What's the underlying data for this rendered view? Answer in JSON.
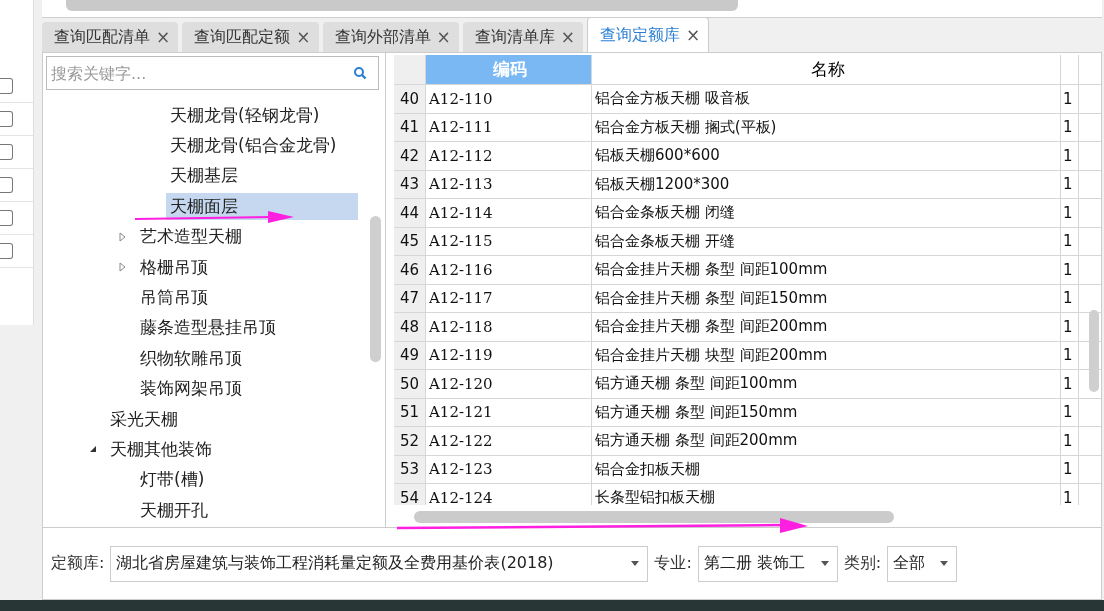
{
  "left_checkboxes": [
    {
      "checked": false
    },
    {
      "checked": false
    },
    {
      "checked": false
    },
    {
      "checked": false
    },
    {
      "checked": false
    },
    {
      "checked": false
    }
  ],
  "tabs": [
    {
      "label": "查询匹配清单",
      "selected": false,
      "close": "×"
    },
    {
      "label": "查询匹配定额",
      "selected": false,
      "close": "×"
    },
    {
      "label": "查询外部清单",
      "selected": false,
      "close": "×"
    },
    {
      "label": "查询清单库",
      "selected": false,
      "close": "×"
    },
    {
      "label": "查询定额库",
      "selected": true,
      "close": "×"
    }
  ],
  "search": {
    "placeholder": "搜索关键字..."
  },
  "tree": [
    {
      "children": [
        {
          "children": [
            {
              "label": "天棚龙骨(轻钢龙骨)",
              "selected": false
            },
            {
              "label": "天棚龙骨(铝合金龙骨)",
              "selected": false
            },
            {
              "label": "天棚基层",
              "selected": false
            },
            {
              "label": "天棚面层",
              "selected": true
            }
          ]
        },
        {
          "label": "艺术造型天棚",
          "selected": false,
          "expanded": false
        },
        {
          "label": "格栅吊顶",
          "selected": false,
          "expanded": false
        },
        {
          "label": "吊筒吊顶",
          "selected": false
        },
        {
          "label": "藤条造型悬挂吊顶",
          "selected": false
        },
        {
          "label": "织物软雕吊顶",
          "selected": false
        },
        {
          "label": "装饰网架吊顶",
          "selected": false
        }
      ]
    },
    {
      "label": "采光天棚",
      "selected": false
    },
    {
      "label": "天棚其他装饰",
      "selected": false,
      "expanded": true,
      "children": [
        {
          "label": "灯带(槽)",
          "selected": false
        },
        {
          "label": "天棚开孔",
          "selected": false
        }
      ]
    }
  ],
  "table": {
    "columns": [
      {
        "label": "编码",
        "selected": true
      },
      {
        "label": "名称",
        "selected": false
      }
    ],
    "rows": [
      {
        "no": "40",
        "code": "A12-110",
        "name": "铝合金方板天棚 吸音板",
        "column_3": "1"
      },
      {
        "no": "41",
        "code": "A12-111",
        "name": "铝合金方板天棚 搁式(平板)",
        "column_3": "1"
      },
      {
        "no": "42",
        "code": "A12-112",
        "name": "铝板天棚600*600",
        "column_3": "1"
      },
      {
        "no": "43",
        "code": "A12-113",
        "name": "铝板天棚1200*300",
        "column_3": "1"
      },
      {
        "no": "44",
        "code": "A12-114",
        "name": "铝合金条板天棚 闭缝",
        "column_3": "1"
      },
      {
        "no": "45",
        "code": "A12-115",
        "name": "铝合金条板天棚 开缝",
        "column_3": "1"
      },
      {
        "no": "46",
        "code": "A12-116",
        "name": "铝合金挂片天棚 条型 间距100mm",
        "column_3": "1"
      },
      {
        "no": "47",
        "code": "A12-117",
        "name": "铝合金挂片天棚 条型 间距150mm",
        "column_3": "1"
      },
      {
        "no": "48",
        "code": "A12-118",
        "name": "铝合金挂片天棚 条型 间距200mm",
        "column_3": "1"
      },
      {
        "no": "49",
        "code": "A12-119",
        "name": "铝合金挂片天棚 块型 间距200mm",
        "column_3": "1"
      },
      {
        "no": "50",
        "code": "A12-120",
        "name": "铝方通天棚 条型 间距100mm",
        "column_3": "1"
      },
      {
        "no": "51",
        "code": "A12-121",
        "name": "铝方通天棚 条型 间距150mm",
        "column_3": "1"
      },
      {
        "no": "52",
        "code": "A12-122",
        "name": "铝方通天棚 条型 间距200mm",
        "column_3": "1"
      },
      {
        "no": "53",
        "code": "A12-123",
        "name": "铝合金扣板天棚",
        "column_3": "1"
      },
      {
        "no": "54",
        "code": "A12-124",
        "name": "长条型铝扣板天棚",
        "column_3": "1"
      }
    ]
  },
  "filters": [
    {
      "label": "定额库:",
      "value": "湖北省房屋建筑与装饰工程消耗量定额及全费用基价表(2018)",
      "kind": "wide"
    },
    {
      "label": "专业:",
      "value": "第二册 装饰工",
      "kind": "medium"
    },
    {
      "label": "类别:",
      "value": "全部",
      "kind": "narrow"
    }
  ]
}
